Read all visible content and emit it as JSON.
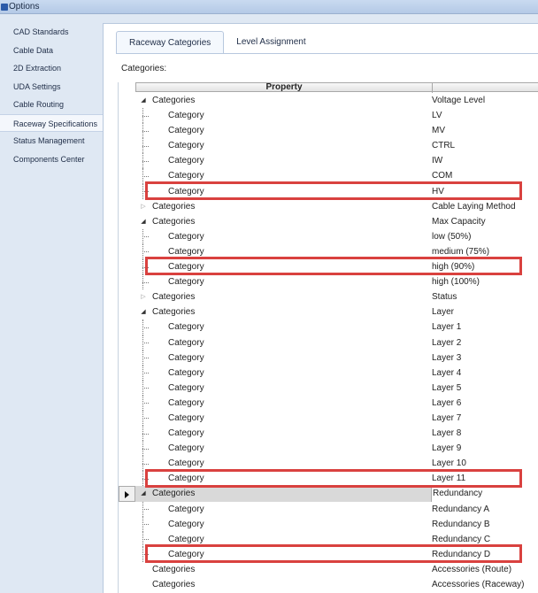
{
  "window": {
    "title": "Options"
  },
  "sidebar": {
    "items": [
      {
        "label": "CAD Standards",
        "selected": false
      },
      {
        "label": "Cable Data",
        "selected": false
      },
      {
        "label": "2D Extraction",
        "selected": false
      },
      {
        "label": "UDA Settings",
        "selected": false
      },
      {
        "label": "Cable Routing",
        "selected": false
      },
      {
        "label": "Raceway Specifications",
        "selected": true
      },
      {
        "label": "Status Management",
        "selected": false
      },
      {
        "label": "Components Center",
        "selected": false
      }
    ]
  },
  "tabs": [
    {
      "label": "Raceway Categories",
      "active": true
    },
    {
      "label": "Level Assignment",
      "active": false
    }
  ],
  "main": {
    "categories_label": "Categories:"
  },
  "grid": {
    "header_property": "Property",
    "rows": [
      {
        "name": "Categories",
        "value": "Voltage Level",
        "level": 0,
        "expander": "expanded"
      },
      {
        "name": "Category",
        "value": "LV",
        "level": 1
      },
      {
        "name": "Category",
        "value": "MV",
        "level": 1
      },
      {
        "name": "Category",
        "value": "CTRL",
        "level": 1
      },
      {
        "name": "Category",
        "value": "IW",
        "level": 1
      },
      {
        "name": "Category",
        "value": "COM",
        "level": 1
      },
      {
        "name": "Category",
        "value": "HV",
        "level": 1,
        "highlighted": true
      },
      {
        "name": "Categories",
        "value": "Cable Laying Method",
        "level": 0,
        "expander": "collapsed"
      },
      {
        "name": "Categories",
        "value": "Max Capacity",
        "level": 0,
        "expander": "expanded"
      },
      {
        "name": "Category",
        "value": "low (50%)",
        "level": 1
      },
      {
        "name": "Category",
        "value": "medium (75%)",
        "level": 1
      },
      {
        "name": "Category",
        "value": "high (90%)",
        "level": 1,
        "highlighted": true
      },
      {
        "name": "Category",
        "value": "high (100%)",
        "level": 1
      },
      {
        "name": "Categories",
        "value": "Status",
        "level": 0,
        "expander": "collapsed"
      },
      {
        "name": "Categories",
        "value": "Layer",
        "level": 0,
        "expander": "expanded"
      },
      {
        "name": "Category",
        "value": "Layer 1",
        "level": 1
      },
      {
        "name": "Category",
        "value": "Layer 2",
        "level": 1
      },
      {
        "name": "Category",
        "value": "Layer 3",
        "level": 1
      },
      {
        "name": "Category",
        "value": "Layer 4",
        "level": 1
      },
      {
        "name": "Category",
        "value": "Layer 5",
        "level": 1
      },
      {
        "name": "Category",
        "value": "Layer 6",
        "level": 1
      },
      {
        "name": "Category",
        "value": "Layer 7",
        "level": 1
      },
      {
        "name": "Category",
        "value": "Layer 8",
        "level": 1
      },
      {
        "name": "Category",
        "value": "Layer 9",
        "level": 1
      },
      {
        "name": "Category",
        "value": "Layer 10",
        "level": 1
      },
      {
        "name": "Category",
        "value": "Layer 11",
        "level": 1,
        "highlighted": true
      },
      {
        "name": "Categories",
        "value": "Redundancy",
        "level": 0,
        "expander": "expanded",
        "current": true
      },
      {
        "name": "Category",
        "value": "Redundancy A",
        "level": 1
      },
      {
        "name": "Category",
        "value": "Redundancy B",
        "level": 1
      },
      {
        "name": "Category",
        "value": "Redundancy C",
        "level": 1
      },
      {
        "name": "Category",
        "value": "Redundancy D",
        "level": 1,
        "highlighted": true
      },
      {
        "name": "Categories",
        "value": "Accessories (Route)",
        "level": 0,
        "expander": "none"
      },
      {
        "name": "Categories",
        "value": "Accessories (Raceway)",
        "level": 0,
        "expander": "none"
      }
    ]
  },
  "colors": {
    "highlight_border": "#d9413f",
    "sidebar_bg": "#dfe8f3"
  },
  "icons": {
    "expanded": "triangle-expanded-icon",
    "collapsed": "triangle-collapsed-icon",
    "current_row": "row-pointer-icon"
  }
}
